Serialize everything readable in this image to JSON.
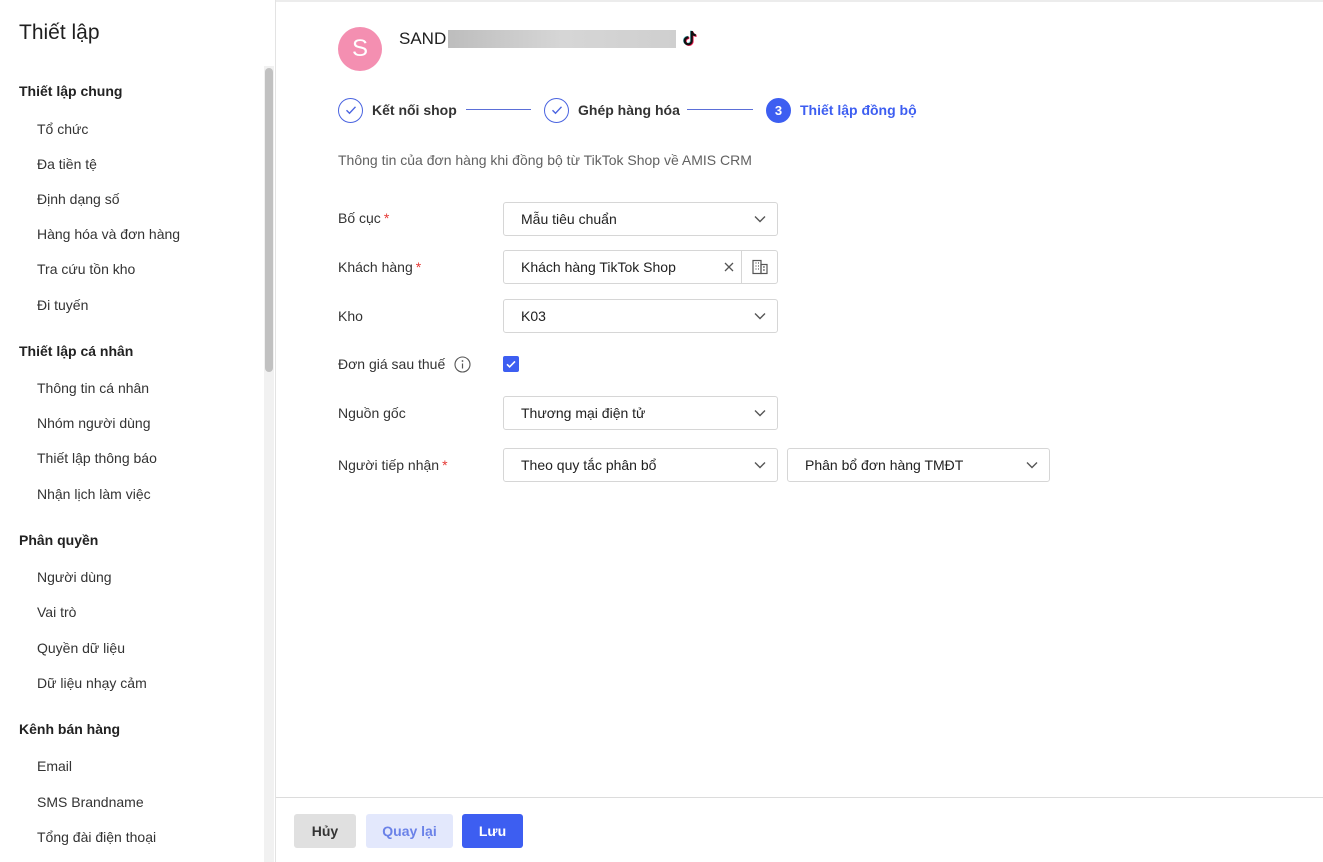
{
  "sidebar": {
    "title": "Thiết lập",
    "groups": [
      {
        "title": "Thiết lập chung",
        "items": [
          "Tổ chức",
          "Đa tiền tệ",
          "Định dạng số",
          "Hàng hóa và đơn hàng",
          "Tra cứu tồn kho",
          "Đi tuyến"
        ]
      },
      {
        "title": "Thiết lập cá nhân",
        "items": [
          "Thông tin cá nhân",
          "Nhóm người dùng",
          "Thiết lập thông báo",
          "Nhận lịch làm việc"
        ]
      },
      {
        "title": "Phân quyền",
        "items": [
          "Người dùng",
          "Vai trò",
          "Quyền dữ liệu",
          "Dữ liệu nhạy cảm"
        ]
      },
      {
        "title": "Kênh bán hàng",
        "items": [
          "Email",
          "SMS Brandname",
          "Tổng đài điện thoại"
        ]
      }
    ]
  },
  "shop": {
    "avatar_letter": "S",
    "name": "SAND"
  },
  "stepper": {
    "steps": [
      {
        "label": "Kết nối shop",
        "state": "done"
      },
      {
        "label": "Ghép hàng hóa",
        "state": "done"
      },
      {
        "label": "Thiết lập đồng bộ",
        "state": "active",
        "number": "3"
      }
    ]
  },
  "intro": "Thông tin của đơn hàng khi đồng bộ từ TikTok Shop về AMIS CRM",
  "form": {
    "layout": {
      "label": "Bố cục",
      "required_mark": "*",
      "value": "Mẫu tiêu chuẩn"
    },
    "customer": {
      "label": "Khách hàng",
      "required_mark": "*",
      "value": "Khách hàng TikTok Shop"
    },
    "warehouse": {
      "label": "Kho",
      "value": "K03"
    },
    "price_after_tax": {
      "label": "Đơn giá sau thuế",
      "checked": true
    },
    "source": {
      "label": "Nguồn gốc",
      "value": "Thương mại điện tử"
    },
    "receiver": {
      "label": "Người tiếp nhận",
      "required_mark": "*",
      "value": "Theo quy tắc phân bổ",
      "rule": "Phân bổ đơn hàng TMĐT"
    }
  },
  "footer": {
    "cancel": "Hủy",
    "back": "Quay lại",
    "save": "Lưu"
  },
  "colors": {
    "primary": "#3d5ef1",
    "avatar": "#f48fb1",
    "required": "#e53935"
  }
}
